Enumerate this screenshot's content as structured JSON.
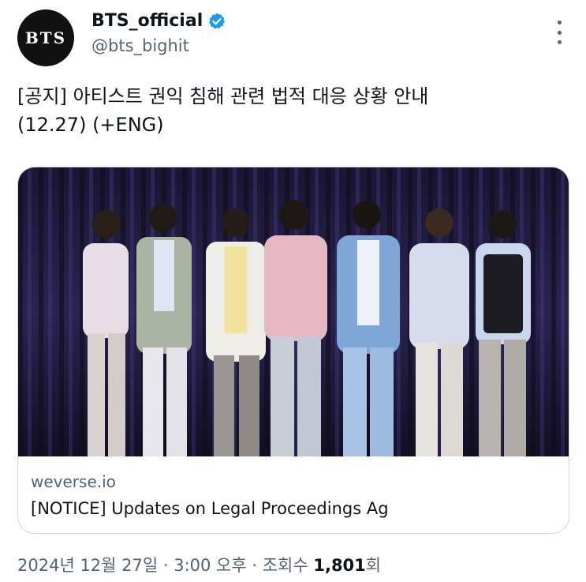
{
  "author": {
    "avatar_text": "BTS",
    "display_name": "BTS_official",
    "handle": "@bts_bighit",
    "verified_color": "#1d9bf0"
  },
  "tweet": {
    "line1": "[공지] 아티스트 권익 침해 관련 법적 대응 상황 안내",
    "line2": "(12.27) (+ENG)"
  },
  "card": {
    "image_alt": "Seven members of BTS standing in a row in pastel outfits in front of a dark purple curtain",
    "domain": "weverse.io",
    "title": "[NOTICE] Updates on Legal Proceedings Ag"
  },
  "meta": {
    "datetime": "2024년 12월 27일 · 3:00 오후 · 조회수 ",
    "views": "1,801",
    "views_suffix": "회"
  },
  "icons": {
    "more": "more-vertical-icon",
    "verified": "verified-badge-icon"
  }
}
